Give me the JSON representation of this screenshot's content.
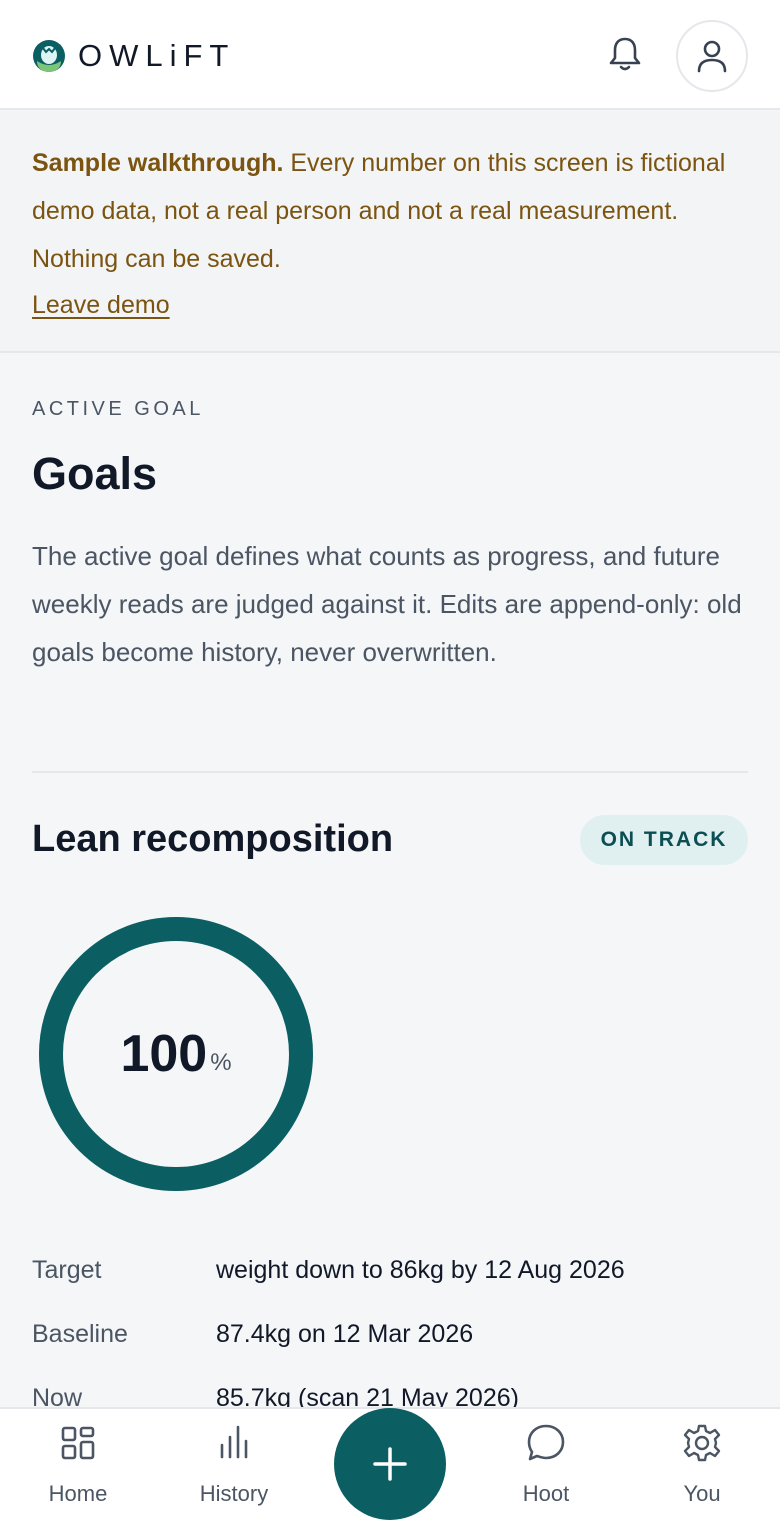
{
  "header": {
    "brand": "OWLiFT",
    "logo_icon": "owl-logo-icon",
    "bell_icon": "bell-icon",
    "avatar_icon": "user-icon"
  },
  "banner": {
    "strong": "Sample walkthrough.",
    "text": " Every number on this screen is fictional demo data, not a real person and not a real measurement. Nothing can be saved.",
    "link": "Leave demo"
  },
  "page": {
    "eyebrow": "ACTIVE GOAL",
    "title": "Goals",
    "description": "The active goal defines what counts as progress, and future weekly reads are judged against it. Edits are append-only: old goals become history, never overwritten."
  },
  "goal": {
    "name": "Lean recomposition",
    "status": "ON TRACK",
    "progress": "100",
    "progress_fraction": 1.0,
    "progress_unit": "%",
    "details": [
      {
        "label": "Target",
        "value": "weight down to 86kg by 12 Aug 2026"
      },
      {
        "label": "Baseline",
        "value": "87.4kg on 12 Mar 2026"
      },
      {
        "label": "Now",
        "value": "85.7kg (scan 21 May 2026)"
      }
    ]
  },
  "nav": {
    "items": [
      {
        "label": "Home",
        "icon": "grid-icon"
      },
      {
        "label": "History",
        "icon": "bar-chart-icon"
      },
      {
        "label": "Hoot",
        "icon": "chat-bubble-icon"
      },
      {
        "label": "You",
        "icon": "gear-icon"
      }
    ],
    "fab_icon": "plus-icon"
  },
  "colors": {
    "accent": "#0b5f62",
    "banner_text": "#7a5410",
    "badge_bg": "#e0efef"
  }
}
